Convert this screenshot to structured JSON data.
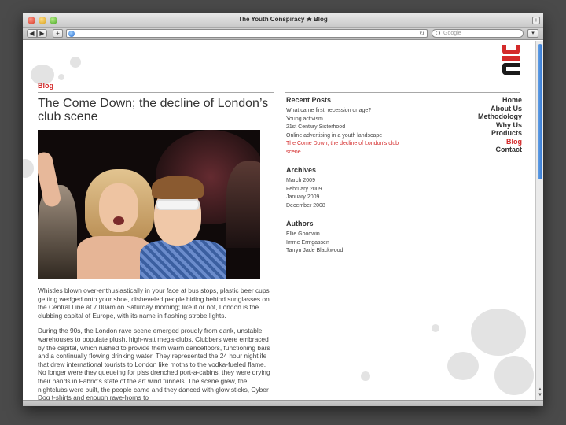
{
  "window": {
    "title": "The Youth Conspiracy ★ Blog"
  },
  "toolbar": {
    "back_icon": "back-arrow-icon",
    "forward_icon": "forward-arrow-icon",
    "add_icon": "plus-icon",
    "url": "",
    "search_placeholder": "Google"
  },
  "page": {
    "section_label": "Blog",
    "post_title": "The Come Down; the decline of London’s club scene",
    "photo_credit": "",
    "paragraphs": [
      "Whistles blown over-enthusiastically in your face at bus stops, plastic beer cups getting wedged onto your shoe, disheveled people hiding behind sunglasses on the Central Line at 7.00am on Saturday morning; like it or not, London is the clubbing capital of Europe, with its name in flashing strobe lights.",
      "During the 90s, the London rave scene emerged proudly from dank, unstable warehouses to populate plush, high-watt mega-clubs. Clubbers were embraced by the capital, which rushed to provide them warm dancefloors, functioning bars and a continually flowing drinking water. They represented the 24 hour nightlife that drew international tourists to London like moths to the vodka-fueled flame. No longer were they queueing for piss drenched port-a-cabins, they were drying their hands in Fabric’s state of the art wind tunnels. The scene grew, the nightclubs were built, the people came and they danced with glow sticks, Cyber Dog t-shirts and enough rave-horns to"
    ]
  },
  "sidebar": {
    "recent_posts": {
      "heading": "Recent Posts",
      "items": [
        "What came first, recession or age?",
        "Young activism",
        "21st Century Sisterhood",
        "Online advertising in a youth landscape",
        "The Come Down; the decline of London’s club scene"
      ]
    },
    "archives": {
      "heading": "Archives",
      "items": [
        "March 2009",
        "February 2009",
        "January 2009",
        "December 2008"
      ]
    },
    "authors": {
      "heading": "Authors",
      "items": [
        "Ellie Goodwin",
        "Imme Ermgassen",
        "Tarryn Jade Blackwood"
      ]
    }
  },
  "nav": {
    "items": [
      "Home",
      "About Us",
      "Methodology",
      "Why Us",
      "Products",
      "Blog",
      "Contact"
    ],
    "active": "Blog"
  },
  "colors": {
    "accent": "#d42a2a",
    "text": "#444444",
    "heading": "#333333"
  }
}
